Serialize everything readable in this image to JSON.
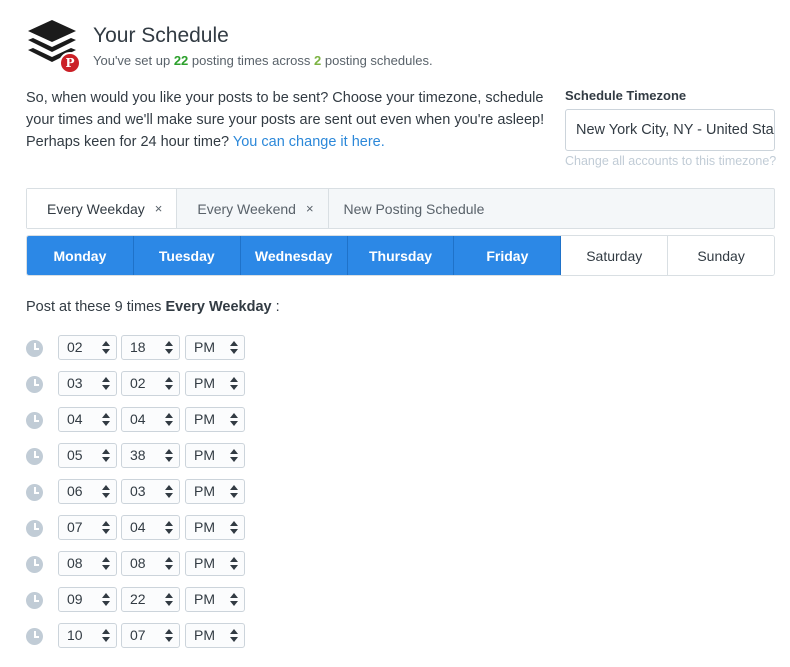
{
  "header": {
    "title": "Your Schedule",
    "subtitle_pre": "You've set up",
    "posting_times_count": "22",
    "subtitle_mid": "posting times across",
    "schedules_count": "2",
    "subtitle_post": "posting schedules.",
    "pinterest_badge": "P"
  },
  "intro": {
    "line1": "So, when would you like your posts to be sent? Choose your timezone, schedule your times and we'll make sure your posts are sent out even when you're asleep!",
    "line2_text": "Perhaps keen for 24 hour time?",
    "line2_link": "You can change it here."
  },
  "timezone": {
    "label": "Schedule Timezone",
    "value": "New York City, NY - United States",
    "change_link": "Change all accounts to this timezone?"
  },
  "tabs": [
    {
      "label": "Every Weekday",
      "close": "×"
    },
    {
      "label": "Every Weekend",
      "close": "×"
    },
    {
      "label": "New Posting Schedule"
    }
  ],
  "days": [
    "Monday",
    "Tuesday",
    "Wednesday",
    "Thursday",
    "Friday",
    "Saturday",
    "Sunday"
  ],
  "post_at": {
    "prefix": "Post at these 9 times",
    "schedule_name": "Every Weekday",
    "suffix": ":"
  },
  "times": [
    {
      "hour": "02",
      "minute": "18",
      "ampm": "PM"
    },
    {
      "hour": "03",
      "minute": "02",
      "ampm": "PM"
    },
    {
      "hour": "04",
      "minute": "04",
      "ampm": "PM"
    },
    {
      "hour": "05",
      "minute": "38",
      "ampm": "PM"
    },
    {
      "hour": "06",
      "minute": "03",
      "ampm": "PM"
    },
    {
      "hour": "07",
      "minute": "04",
      "ampm": "PM"
    },
    {
      "hour": "08",
      "minute": "08",
      "ampm": "PM"
    },
    {
      "hour": "09",
      "minute": "22",
      "ampm": "PM"
    },
    {
      "hour": "10",
      "minute": "07",
      "ampm": "PM"
    }
  ],
  "colors": {
    "accent_blue": "#2c88e6",
    "count_green": "#2ca02c",
    "pinterest_red": "#cb2027"
  }
}
